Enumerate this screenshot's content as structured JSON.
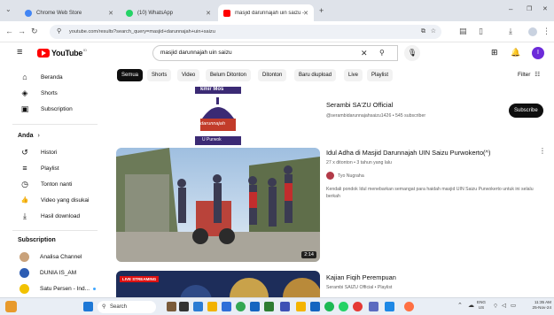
{
  "browser": {
    "tabs": [
      {
        "title": "Chrome Web Store",
        "color": "#4285f4"
      },
      {
        "title": "(10) WhatsApp",
        "color": "#25d366"
      },
      {
        "title": "masjid darunnajah uin saizu - YouTube",
        "color": "#ff0000"
      }
    ],
    "new_tab": "+",
    "url": "youtube.com/results?search_query=masjid+darunnajah+uin+saizu"
  },
  "youtube": {
    "logo_text": "YouTube",
    "region": "ID",
    "search_value": "masjid darunnajah uin saizu",
    "avatar_letter": "I",
    "filter_label": "Filter"
  },
  "sidebar": {
    "main": [
      {
        "label": "Beranda",
        "icon": "home-icon",
        "glyph": "⌂"
      },
      {
        "label": "Shorts",
        "icon": "shorts-icon",
        "glyph": "◈"
      },
      {
        "label": "Subscription",
        "icon": "subscription-icon",
        "glyph": "▣"
      }
    ],
    "you_heading": "Anda",
    "you_items": [
      {
        "label": "Histori",
        "icon": "history-icon",
        "glyph": "↺"
      },
      {
        "label": "Playlist",
        "icon": "playlist-icon",
        "glyph": "≡"
      },
      {
        "label": "Tonton nanti",
        "icon": "watch-later-icon",
        "glyph": "◷"
      },
      {
        "label": "Video yang disukai",
        "icon": "like-icon",
        "glyph": "👍"
      },
      {
        "label": "Hasil download",
        "icon": "download-icon",
        "glyph": "⤓"
      }
    ],
    "subs_heading": "Subscription",
    "subs": [
      {
        "label": "Analisa Channel",
        "color": "#c9a27b"
      },
      {
        "label": "DUNIA IS_AM",
        "color": "#2d5db3"
      },
      {
        "label": "Satu Persen - Ind...",
        "color": "#f2c200"
      }
    ]
  },
  "chips": [
    "Semua",
    "Shorts",
    "Video",
    "Belum Ditonton",
    "Ditonton",
    "Baru diupload",
    "Live",
    "Playlist"
  ],
  "results": [
    {
      "type": "channel",
      "title": "Serambi SA'ZU Official",
      "meta": "@serambidarunnajahsaizu1426 • 545 subscriber",
      "action": "Subscribe",
      "logo_text": "darunnajah",
      "logo_top": "kmir Mos",
      "logo_bottom": "U Purwok"
    },
    {
      "type": "video",
      "title": "Idul Adha di Masjid Darunnajah UIN Saizu Purwokerto(^)",
      "meta": "27 x ditonton • 3 tahun yang lalu",
      "channel": "Tyo Nugraha",
      "desc": "Kendali pondok Idul menebarkan semangat para haidah masjid UIN Saizu Purwokerto untuk ini selalu berkah",
      "duration": "2:14"
    },
    {
      "type": "video",
      "title": "Kajian Fiqih Perempuan",
      "meta": "Serambi SAIZU Official • Playlist",
      "badge": "LIVE STREAMING"
    }
  ],
  "taskbar": {
    "search": "Search",
    "lang": "ENG",
    "region": "US",
    "time": "11:35 AM",
    "date": "25-Nov-24"
  }
}
